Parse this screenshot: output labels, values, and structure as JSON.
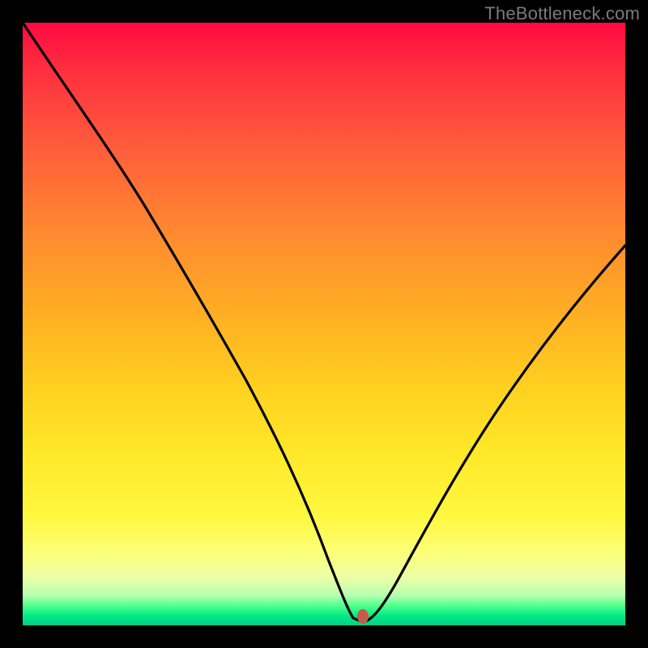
{
  "watermark": {
    "text": "TheBottleneck.com"
  },
  "marker_color": "#c75a4a",
  "chart_data": {
    "type": "line",
    "title": "",
    "xlabel": "",
    "ylabel": "",
    "xlim": [
      0,
      100
    ],
    "ylim": [
      0,
      100
    ],
    "grid": false,
    "legend": false,
    "annotations": [
      {
        "name": "marker",
        "x": 56,
        "y": 2
      }
    ],
    "background_gradient": [
      {
        "pos": 0,
        "color": "#ff0a40"
      },
      {
        "pos": 35,
        "color": "#ff8a30"
      },
      {
        "pos": 72,
        "color": "#ffe92a"
      },
      {
        "pos": 97,
        "color": "#43ff8a"
      },
      {
        "pos": 100,
        "color": "#00d184"
      }
    ],
    "series": [
      {
        "name": "bottleneck-curve",
        "x": [
          0,
          6,
          12,
          18,
          24,
          30,
          36,
          42,
          48,
          52,
          54,
          56,
          58,
          62,
          68,
          76,
          84,
          92,
          100
        ],
        "y": [
          100,
          90,
          80,
          70,
          61,
          52,
          42,
          30,
          15,
          6,
          2,
          1,
          2,
          8,
          18,
          32,
          45,
          56,
          64
        ]
      }
    ]
  }
}
